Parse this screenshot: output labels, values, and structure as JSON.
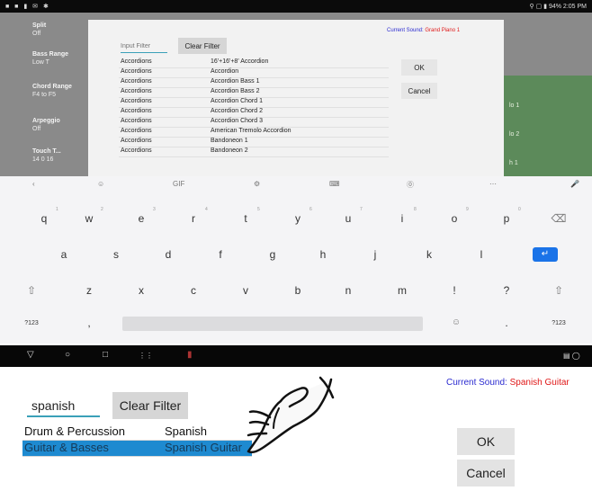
{
  "status_bar": {
    "left_icons": "■ ■ ▮ ✉ ✱",
    "right_text": "⚲ ▢ ▮ 94% 2:05 PM"
  },
  "side_panel": [
    {
      "label": "Split",
      "value": "Off"
    },
    {
      "label": "Bass Range",
      "value": "Low T"
    },
    {
      "label": "Chord Range",
      "value": "F4 to F5"
    },
    {
      "label": "Arpeggio",
      "value": "Off"
    },
    {
      "label": "Touch T...",
      "value": "14    0 16"
    }
  ],
  "green_panel": [
    "lo 1",
    "lo 2",
    "h 1"
  ],
  "top_dialog": {
    "filter_placeholder": "Input Filter",
    "clear_filter": "Clear Filter",
    "current_sound_label": "Current Sound:",
    "current_sound_value": "Grand Piano 1",
    "ok": "OK",
    "cancel": "Cancel",
    "rows": [
      {
        "category": "Accordions",
        "sound": "16'+16'+8' Accordion"
      },
      {
        "category": "Accordions",
        "sound": "Accordion"
      },
      {
        "category": "Accordions",
        "sound": "Accordion Bass 1"
      },
      {
        "category": "Accordions",
        "sound": "Accordion Bass 2"
      },
      {
        "category": "Accordions",
        "sound": "Accordion Chord 1"
      },
      {
        "category": "Accordions",
        "sound": "Accordion Chord 2"
      },
      {
        "category": "Accordions",
        "sound": "Accordion Chord 3"
      },
      {
        "category": "Accordions",
        "sound": "American Tremolo Accordion"
      },
      {
        "category": "Accordions",
        "sound": "Bandoneon 1"
      },
      {
        "category": "Accordions",
        "sound": "Bandoneon 2"
      }
    ]
  },
  "keyboard": {
    "toolbar": [
      "‹",
      "☺",
      "GIF",
      "⚙",
      "⌨",
      "⓪",
      "⋯",
      "🎤"
    ],
    "row1": [
      "q",
      "w",
      "e",
      "r",
      "t",
      "y",
      "u",
      "i",
      "o",
      "p",
      "⌫"
    ],
    "row1_hints": [
      "1",
      "2",
      "3",
      "4",
      "5",
      "6",
      "7",
      "8",
      "9",
      "0"
    ],
    "row2": [
      "a",
      "s",
      "d",
      "f",
      "g",
      "h",
      "j",
      "k",
      "l",
      "↵"
    ],
    "row3": [
      "⇧",
      "z",
      "x",
      "c",
      "v",
      "b",
      "n",
      "m",
      "!",
      "?",
      "⇧"
    ],
    "row4": [
      "?123",
      ",",
      "☺",
      ".",
      "?123"
    ]
  },
  "nav_bar": [
    "▽",
    "○",
    "□",
    "⋮⋮",
    "▮",
    "▤ ◯"
  ],
  "bottom_dialog": {
    "filter_value": "spanish",
    "clear_filter": "Clear Filter",
    "current_sound_label": "Current Sound:",
    "current_sound_value": "Spanish Guitar",
    "ok": "OK",
    "cancel": "Cancel",
    "rows": [
      {
        "category": "Drum & Percussion",
        "sound": "Spanish Castane",
        "selected": false
      },
      {
        "category": "Guitar & Basses",
        "sound": "Spanish Guitar",
        "selected": true
      }
    ]
  },
  "colors": {
    "accent_blue": "#1e8ad0",
    "sound_label": "#2a2ad0",
    "sound_value": "#e01818",
    "filter_underline": "#3aa0b8"
  }
}
